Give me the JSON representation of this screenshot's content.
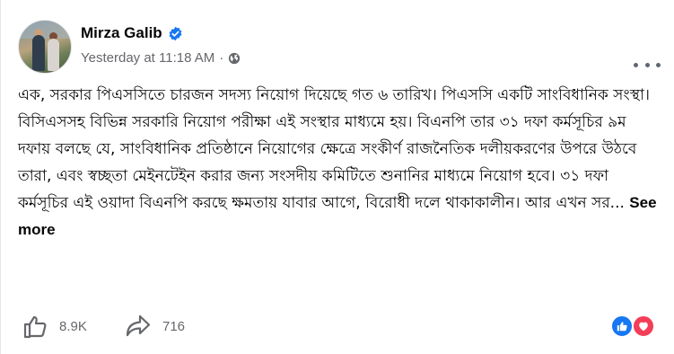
{
  "author": {
    "name": "Mirza Galib",
    "verified": true,
    "avatar_icon": "profile-photo"
  },
  "meta": {
    "timestamp": "Yesterday at 11:18 AM",
    "separator": "·",
    "audience_icon": "globe-icon"
  },
  "post": {
    "text": "এক, সরকার পিএসসিতে চারজন সদস্য নিয়োগ দিয়েছে গত ৬ তারিখ। পিএসসি একটি সাংবিধানিক সংস্থা। বিসিএসসহ বিভিন্ন সরকারি নিয়োগ পরীক্ষা এই সংস্থার মাধ্যমে হয়। বিএনপি তার ৩১ দফা কর্মসূচির ৯ম দফায় বলছে যে, সাংবিধানিক প্রতিষ্ঠানে নিয়োগের ক্ষেত্রে সংকীর্ণ রাজনৈতিক দলীয়করণের উপরে উঠবে তারা, এবং স্বচ্ছতা মেইনটেইন করার জন্য সংসদীয় কমিটিতে শুনানির মাধ্যমে নিয়োগ হবে। ৩১ দফা কর্মসূচির এই ওয়াদা বিএনপি করছে ক্ষমতায় যাবার আগে, বিরোধী দলে থাকাকালীন। আর এখন সর...",
    "see_more": "See more"
  },
  "actions": {
    "like_count": "8.9K",
    "share_count": "716"
  },
  "reactions": [
    "like",
    "love"
  ],
  "colors": {
    "verified_blue": "#1877f2",
    "secondary_text": "#65676b",
    "like_blue": "#1877f2",
    "love_red": "#f33e58"
  }
}
